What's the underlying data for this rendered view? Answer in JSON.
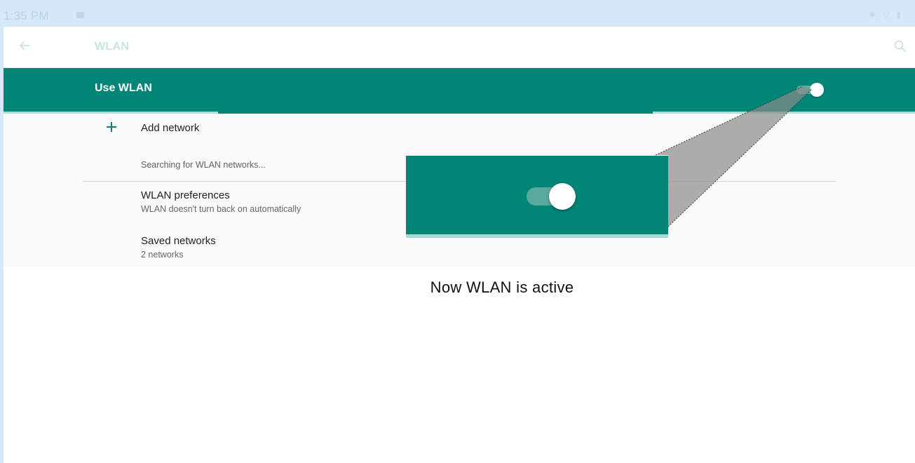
{
  "status_bar": {
    "time": "1:35 PM",
    "icons": [
      "image-notification-icon",
      "bluetooth-icon",
      "wifi-icon",
      "battery-icon"
    ]
  },
  "toolbar": {
    "title": "WLAN",
    "back_icon": "arrow-left-icon",
    "search_icon": "search-icon"
  },
  "master_switch": {
    "label": "Use WLAN",
    "state": "on",
    "accent_color": "#008577"
  },
  "list": {
    "add_network": "Add network",
    "searching": "Searching for WLAN networks...",
    "items": [
      {
        "title": "WLAN preferences",
        "subtitle": "WLAN doesn't turn back on automatically"
      },
      {
        "title": "Saved networks",
        "subtitle": "2 networks"
      }
    ]
  },
  "callout": {
    "caption": "Now WLAN is active",
    "switch_state": "on"
  },
  "colors": {
    "accent": "#008577",
    "background": "#d6e9fb"
  }
}
